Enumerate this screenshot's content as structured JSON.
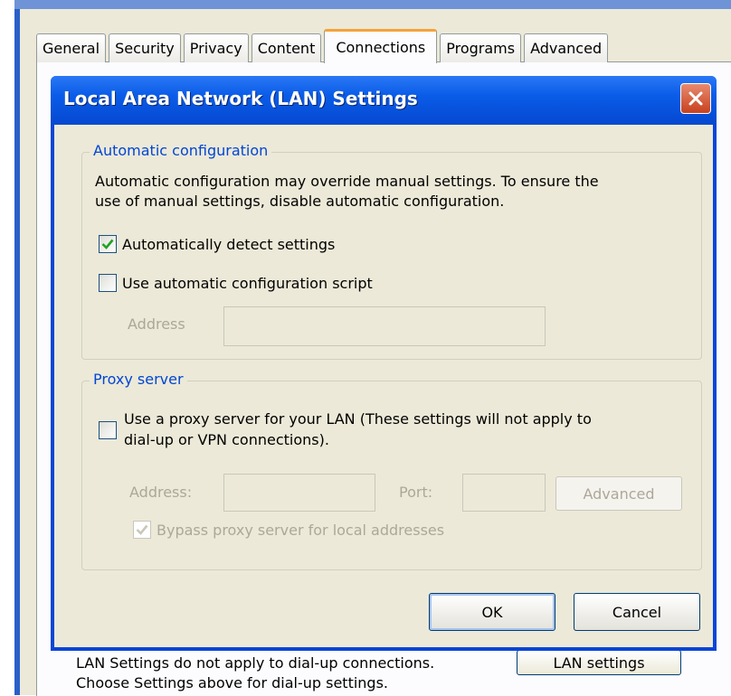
{
  "background_window": {
    "tabs": [
      "General",
      "Security",
      "Privacy",
      "Content",
      "Connections",
      "Programs",
      "Advanced"
    ],
    "active_tab": "Connections",
    "lan_note_line1": "LAN Settings do not apply to dial-up connections.",
    "lan_note_line2": "Choose Settings above for dial-up settings.",
    "lan_settings_button": "LAN settings"
  },
  "dialog": {
    "title": "Local Area Network (LAN) Settings",
    "auto_config": {
      "group_title": "Automatic configuration",
      "description_line1": "Automatic configuration may override manual settings.  To ensure the",
      "description_line2": "use of manual settings, disable automatic configuration.",
      "detect_label": "Automatically detect settings",
      "detect_checked": true,
      "script_label": "Use automatic configuration script",
      "script_checked": false,
      "address_label": "Address",
      "address_value": ""
    },
    "proxy": {
      "group_title": "Proxy server",
      "use_proxy_line1": "Use a proxy server for your LAN (These settings will not apply to",
      "use_proxy_line2": "dial-up or VPN connections).",
      "use_proxy_checked": false,
      "address_label": "Address:",
      "address_value": "",
      "port_label": "Port:",
      "port_value": "",
      "advanced_button": "Advanced",
      "bypass_label": "Bypass proxy server for local addresses",
      "bypass_checked": true
    },
    "ok_button": "OK",
    "cancel_button": "Cancel"
  },
  "colors": {
    "titlebar": "#0a5ce8",
    "group_title": "#0046d5",
    "close_button": "#c8411e",
    "active_tab_highlight": "#f5a33a"
  }
}
